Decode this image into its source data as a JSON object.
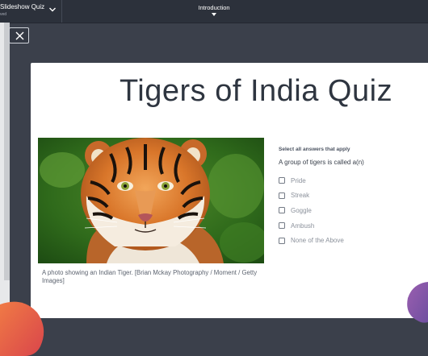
{
  "header": {
    "project_title": "Slideshow Quiz",
    "save_status": "ved",
    "current_tab": "Introduction"
  },
  "slide": {
    "title": "Tigers of India Quiz",
    "image_caption": "A photo showing an Indian Tiger. [Brian Mckay Photography / Moment / Getty Images]",
    "question": {
      "instruction": "Select all answers that apply",
      "text": "A group of tigers is called a(n)",
      "options": [
        {
          "label": "Pride",
          "checked": false
        },
        {
          "label": "Streak",
          "checked": false
        },
        {
          "label": "Goggle",
          "checked": false
        },
        {
          "label": "Ambush",
          "checked": false
        },
        {
          "label": "None of the Above",
          "checked": false
        }
      ]
    }
  },
  "icons": {
    "close": "close-icon",
    "project_menu": "chevron-down-icon",
    "tab_menu": "chevron-down-icon"
  },
  "colors": {
    "background": "#3b404b",
    "topbar": "#2c313b",
    "blob_left": "#e8654a",
    "blob_right": "#8a5aa8"
  }
}
